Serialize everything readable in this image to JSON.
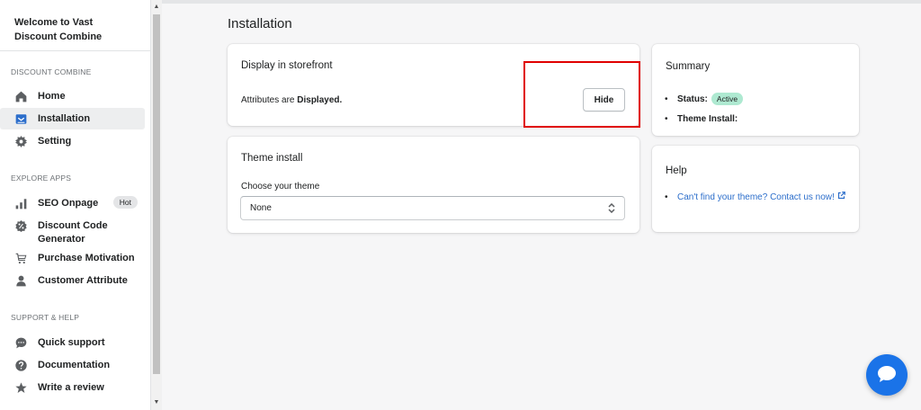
{
  "sidebar": {
    "app_title": "Welcome to Vast Discount Combine",
    "sections": [
      {
        "title": "DISCOUNT COMBINE",
        "items": [
          {
            "label": "Home",
            "icon": "home-icon"
          },
          {
            "label": "Installation",
            "icon": "installation-icon",
            "active": true
          },
          {
            "label": "Setting",
            "icon": "gear-icon"
          }
        ]
      },
      {
        "title": "EXPLORE APPS",
        "items": [
          {
            "label": "SEO Onpage",
            "icon": "bar-chart-icon",
            "badge": "Hot"
          },
          {
            "label": "Discount Code Generator",
            "icon": "discount-icon"
          },
          {
            "label": "Purchase Motivation",
            "icon": "cart-icon"
          },
          {
            "label": "Customer Attribute",
            "icon": "person-icon"
          }
        ]
      },
      {
        "title": "SUPPORT & HELP",
        "items": [
          {
            "label": "Quick support",
            "icon": "chat-bubble-icon"
          },
          {
            "label": "Documentation",
            "icon": "question-icon"
          },
          {
            "label": "Write a review",
            "icon": "star-icon"
          }
        ]
      }
    ]
  },
  "page": {
    "title": "Installation"
  },
  "display_card": {
    "title": "Display in storefront",
    "attr_prefix": "Attributes are ",
    "attr_state": "Displayed.",
    "hide_label": "Hide"
  },
  "theme_card": {
    "title": "Theme install",
    "select_label": "Choose your theme",
    "select_value": "None"
  },
  "summary_card": {
    "title": "Summary",
    "status_label": "Status:",
    "status_value": "Active",
    "theme_install_label": "Theme Install:"
  },
  "help_card": {
    "title": "Help",
    "link_text": "Can't find your theme? Contact us now!"
  },
  "colors": {
    "accent": "#2c6ecb",
    "active_badge": "#aee9d1",
    "chat_button": "#1a73e8",
    "highlight_box": "#e00000"
  }
}
